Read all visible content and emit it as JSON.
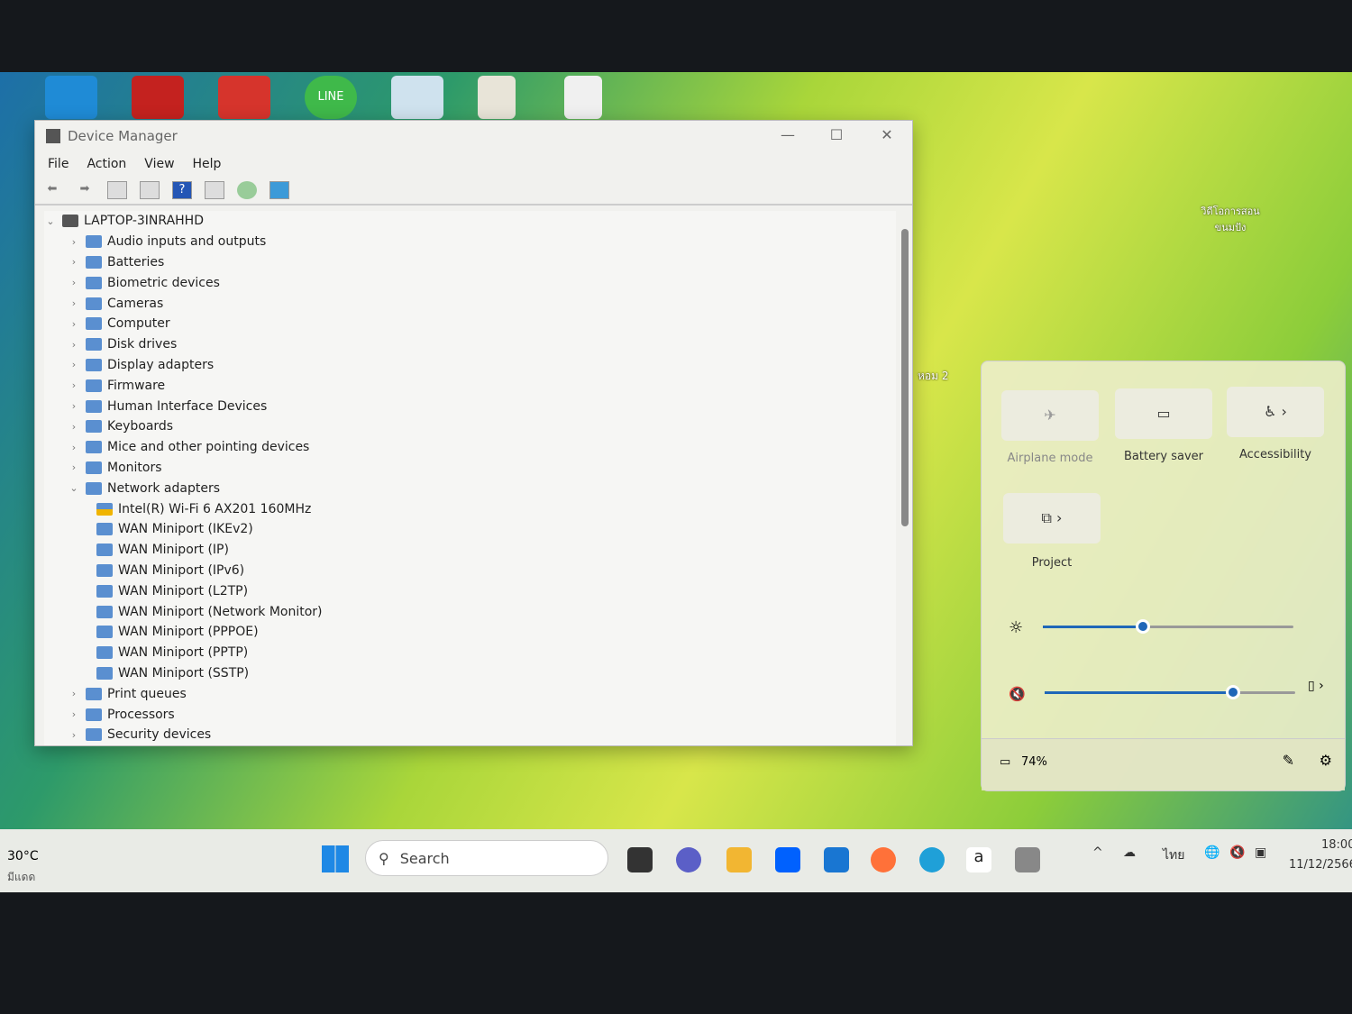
{
  "window": {
    "title": "Device Manager",
    "menu": [
      "File",
      "Action",
      "View",
      "Help"
    ],
    "controls": [
      "—",
      "☐",
      "✕"
    ]
  },
  "toolbar_icons": [
    "back-icon",
    "forward-icon",
    "show-hide-console-tree-icon",
    "properties-icon",
    "help-icon",
    "action-pane-icon",
    "scan-hardware-icon",
    "monitor-icon"
  ],
  "tree": {
    "root": "LAPTOP-3INRAHHD",
    "items": [
      {
        "label": "Audio inputs and outputs",
        "level": 1,
        "state": "collapsed"
      },
      {
        "label": "Batteries",
        "level": 1,
        "state": "collapsed"
      },
      {
        "label": "Biometric devices",
        "level": 1,
        "state": "collapsed"
      },
      {
        "label": "Cameras",
        "level": 1,
        "state": "collapsed"
      },
      {
        "label": "Computer",
        "level": 1,
        "state": "collapsed"
      },
      {
        "label": "Disk drives",
        "level": 1,
        "state": "collapsed"
      },
      {
        "label": "Display adapters",
        "level": 1,
        "state": "collapsed"
      },
      {
        "label": "Firmware",
        "level": 1,
        "state": "collapsed"
      },
      {
        "label": "Human Interface Devices",
        "level": 1,
        "state": "collapsed"
      },
      {
        "label": "Keyboards",
        "level": 1,
        "state": "collapsed"
      },
      {
        "label": "Mice and other pointing devices",
        "level": 1,
        "state": "collapsed"
      },
      {
        "label": "Monitors",
        "level": 1,
        "state": "collapsed"
      },
      {
        "label": "Network adapters",
        "level": 1,
        "state": "expanded"
      },
      {
        "label": "Intel(R) Wi-Fi 6 AX201 160MHz",
        "level": 2,
        "warning": true
      },
      {
        "label": "WAN Miniport (IKEv2)",
        "level": 2
      },
      {
        "label": "WAN Miniport (IP)",
        "level": 2
      },
      {
        "label": "WAN Miniport (IPv6)",
        "level": 2
      },
      {
        "label": "WAN Miniport (L2TP)",
        "level": 2
      },
      {
        "label": "WAN Miniport (Network Monitor)",
        "level": 2
      },
      {
        "label": "WAN Miniport (PPPOE)",
        "level": 2
      },
      {
        "label": "WAN Miniport (PPTP)",
        "level": 2
      },
      {
        "label": "WAN Miniport (SSTP)",
        "level": 2
      },
      {
        "label": "Print queues",
        "level": 1,
        "state": "collapsed"
      },
      {
        "label": "Processors",
        "level": 1,
        "state": "collapsed"
      },
      {
        "label": "Security devices",
        "level": 1,
        "state": "collapsed"
      }
    ]
  },
  "quick_settings": {
    "tiles": [
      {
        "label": "Airplane mode",
        "icon": "airplane-icon",
        "glyph": "✈",
        "active": false
      },
      {
        "label": "Battery saver",
        "icon": "battery-saver-icon",
        "glyph": "▭",
        "active": false
      },
      {
        "label": "Accessibility",
        "icon": "accessibility-icon",
        "glyph": "♿ ›",
        "active": false
      },
      {
        "label": "Project",
        "icon": "project-icon",
        "glyph": "⧉ ›",
        "active": false
      }
    ],
    "brightness_percent": 40,
    "volume_percent": 75,
    "volume_muted": true,
    "battery": "74%"
  },
  "taskbar": {
    "weather_temp": "30°C",
    "weather_desc": "มีแดด",
    "search_placeholder": "Search",
    "language": "ไทย",
    "time": "18:00",
    "date": "11/12/2566"
  },
  "desktop": {
    "folder1": "วิดีโอการสอน ขนมปัง",
    "folder2": "หอม 2",
    "line_label": "LINE"
  },
  "colors": {
    "accent": "#1f67b8"
  }
}
